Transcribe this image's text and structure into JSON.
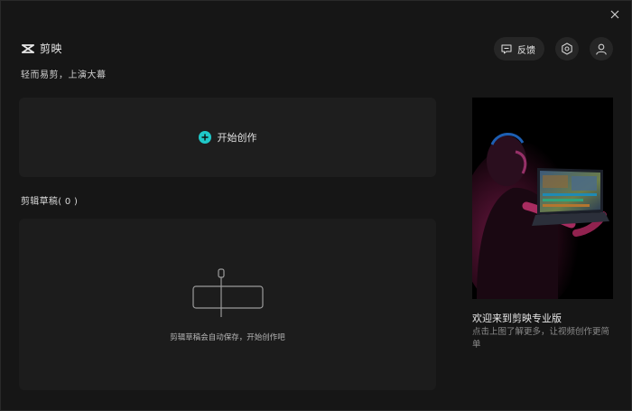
{
  "app": {
    "name": "剪映",
    "slogan": "轻而易剪，上演大幕"
  },
  "header": {
    "feedback_label": "反馈",
    "settings_icon": "gear-icon",
    "user_icon": "user-icon",
    "close_icon": "close-icon"
  },
  "create": {
    "label": "开始创作",
    "accent": "#1fc8c8"
  },
  "drafts": {
    "title": "剪辑草稿( 0 )",
    "empty_text": "剪辑草稿会自动保存，开始创作吧"
  },
  "promo": {
    "title": "欢迎来到剪映专业版",
    "description": "点击上图了解更多，让视频创作更简单"
  }
}
